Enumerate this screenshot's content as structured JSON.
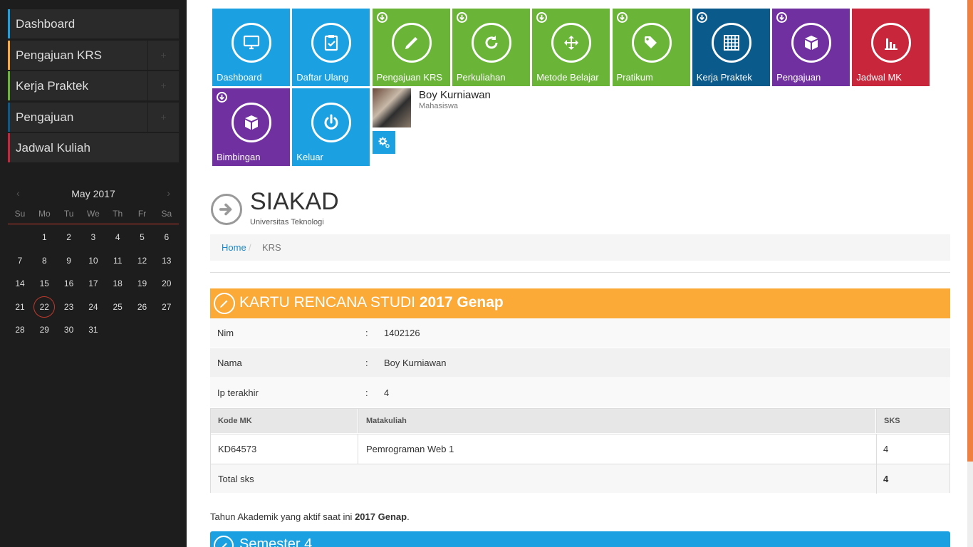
{
  "sidebar": {
    "items": [
      {
        "label": "Dashboard",
        "color": "#1ba1e2",
        "expandable": false
      },
      {
        "label": "Pengajuan KRS",
        "color": "#fba937",
        "expandable": true
      },
      {
        "label": "Kerja Praktek",
        "color": "#6ab437",
        "expandable": true
      },
      {
        "label": "Pengajuan",
        "color": "#0a5a8c",
        "expandable": true
      },
      {
        "label": "Jadwal Kuliah",
        "color": "#c8263b",
        "expandable": false
      }
    ],
    "plus": "+"
  },
  "calendar": {
    "month": "May 2017",
    "prev": "‹",
    "next": "›",
    "weekdays": [
      "Su",
      "Mo",
      "Tu",
      "We",
      "Th",
      "Fr",
      "Sa"
    ],
    "first_weekday_index": 1,
    "days_in_month": 31,
    "today": 22
  },
  "tiles": [
    {
      "label": "Dashboard",
      "color": "#1ba1e2",
      "icon": "monitor-icon",
      "download": false
    },
    {
      "label": "Daftar Ulang",
      "color": "#1ba1e2",
      "icon": "clipboard-check-icon",
      "download": false
    },
    {
      "label": "Pengajuan KRS",
      "color": "#6ab437",
      "icon": "pencil-icon",
      "download": true
    },
    {
      "label": "Perkuliahan",
      "color": "#6ab437",
      "icon": "refresh-icon",
      "download": true
    },
    {
      "label": "Metode Belajar",
      "color": "#6ab437",
      "icon": "move-icon",
      "download": true
    },
    {
      "label": "Pratikum",
      "color": "#6ab437",
      "icon": "tags-icon",
      "download": true
    },
    {
      "label": "Kerja Praktek",
      "color": "#0a5a8c",
      "icon": "grid-icon",
      "download": true
    },
    {
      "label": "Pengajuan",
      "color": "#7030a0",
      "icon": "box-icon",
      "download": true
    },
    {
      "label": "Jadwal MK",
      "color": "#c8263b",
      "icon": "bar-chart-icon",
      "download": false
    },
    {
      "label": "Bimbingan",
      "color": "#7030a0",
      "icon": "box-icon",
      "download": true
    },
    {
      "label": "Keluar",
      "color": "#1ba1e2",
      "icon": "power-icon",
      "download": false
    }
  ],
  "profile": {
    "name": "Boy Kurniawan",
    "role": "Mahasiswa"
  },
  "header": {
    "title": "SIAKAD",
    "subtitle": "Universitas Teknologi"
  },
  "breadcrumb": {
    "home": "Home",
    "separator": "/",
    "current": "KRS"
  },
  "krs": {
    "title_prefix": "KARTU RENCANA STUDI",
    "title_bold": "2017 Genap",
    "colon": ":",
    "rows": [
      {
        "key": "Nim",
        "value": "1402126"
      },
      {
        "key": "Nama",
        "value": "Boy Kurniawan"
      },
      {
        "key": "Ip terakhir",
        "value": "4"
      }
    ],
    "table": {
      "headers": {
        "code": "Kode MK",
        "course": "Matakuliah",
        "sks": "SKS"
      },
      "rows": [
        {
          "code": "KD64573",
          "course": "Pemrograman Web 1",
          "sks": "4"
        }
      ],
      "total_label": "Total sks",
      "total_value": "4"
    }
  },
  "note": {
    "text": "Tahun Akademik yang aktif saat ini",
    "bold": "2017 Genap",
    "end": "."
  },
  "semester": {
    "title": "Semester 4"
  }
}
